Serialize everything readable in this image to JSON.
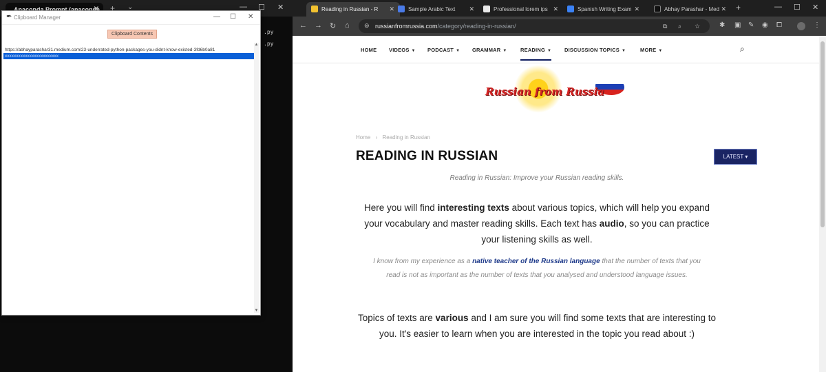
{
  "left_window": {
    "tab_title": "Anaconda Prompt (anaconda",
    "terminal_fragments": [
      ".py",
      ".py"
    ]
  },
  "clipboard_manager": {
    "title": "Clipboard Manager",
    "contents_label": "Clipboard Contents",
    "items": [
      "https://abhayparashar31.medium.com/23-underrated-python-packages-you-didnt-know-existed-3fd6b0a81",
      "xxxxxxxxxxxxxxxxxxxxxxxx"
    ],
    "selected_index": 1
  },
  "browser": {
    "tabs": [
      {
        "title": "Reading in Russian - R",
        "color": "#f2c230",
        "active": true
      },
      {
        "title": "Sample Arabic Text",
        "color": "#4a7be8",
        "active": false
      },
      {
        "title": "Professional lorem ips",
        "color": "#e8e8e8",
        "active": false
      },
      {
        "title": "Spanish Writing Exam",
        "color": "#3b82f6",
        "active": false
      },
      {
        "title": "Abhay Parashar - Med",
        "color": "#111111",
        "active": false
      }
    ],
    "url_domain": "russianfromrussia.com",
    "url_path": "/category/reading-in-russian/"
  },
  "site": {
    "nav": [
      {
        "label": "HOME",
        "dropdown": false,
        "active": false
      },
      {
        "label": "VIDEOS",
        "dropdown": true,
        "active": false
      },
      {
        "label": "PODCAST",
        "dropdown": true,
        "active": false
      },
      {
        "label": "GRAMMAR",
        "dropdown": true,
        "active": false
      },
      {
        "label": "READING",
        "dropdown": true,
        "active": true
      },
      {
        "label": "DISCUSSION TOPICS",
        "dropdown": true,
        "active": false
      },
      {
        "label": "MORE",
        "dropdown": true,
        "active": false
      }
    ],
    "logo_text": "Russian from Russia",
    "breadcrumb": {
      "home": "Home",
      "separator": "›",
      "current": "Reading in Russian"
    },
    "title": "READING IN RUSSIAN",
    "latest_button": "LATEST",
    "subtitle": "Reading in Russian: Improve your Russian reading skills.",
    "para1": {
      "p1": "Here you will find ",
      "b1": "interesting texts",
      "p2": " about various topics, which will help you expand your vocabulary and master reading skills. Each text has ",
      "b2": "audio",
      "p3": ", so you can practice your listening skills as well."
    },
    "quote": {
      "p1": "I know from my experience as a ",
      "link": "native teacher of the Russian language",
      "p2": " that the number of texts that you read is not as important as the number of texts that you analysed and understood language issues."
    },
    "para2": {
      "p1": "Topics of texts are ",
      "b1": "various",
      "p2": " and I am sure you will find some texts that are interesting to you. It's easier to learn when you are interested in the topic you read about :)"
    }
  },
  "colors": {
    "accent_navy": "#1a2463",
    "selection_blue": "#0a5fd7",
    "label_peach": "#f7c7b3"
  }
}
